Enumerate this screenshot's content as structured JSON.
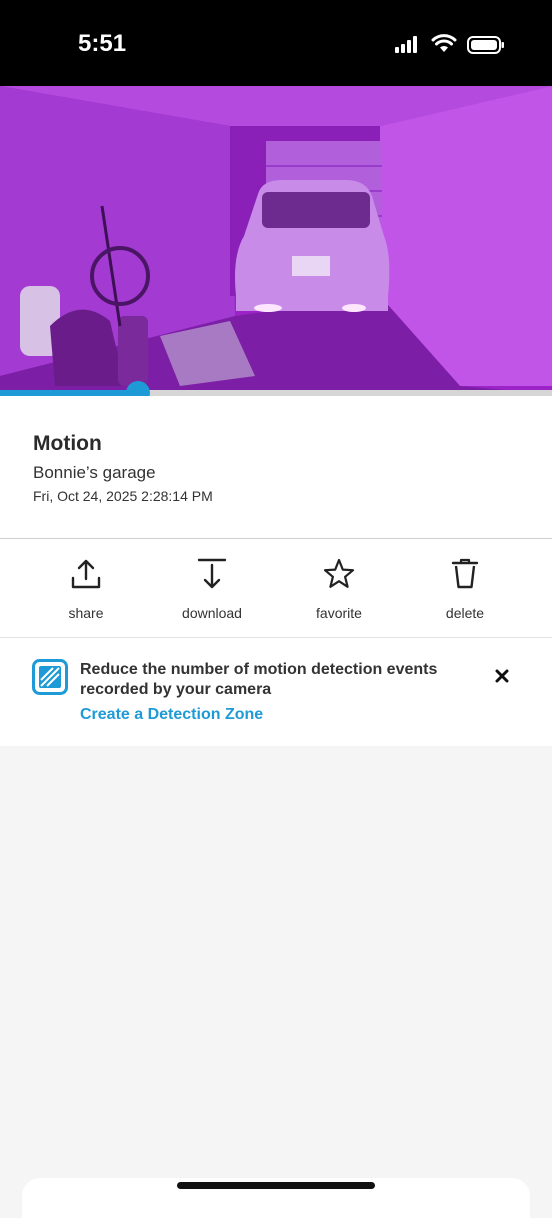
{
  "status_bar": {
    "time": "5:51"
  },
  "event": {
    "title": "Motion",
    "device": "Bonnie’s garage",
    "timestamp": "Fri, Oct 24, 2025 2:28:14 PM"
  },
  "playback": {
    "progress": 0.25
  },
  "actions": [
    {
      "label": "share",
      "icon": "share-icon"
    },
    {
      "label": "download",
      "icon": "download-icon"
    },
    {
      "label": "favorite",
      "icon": "star-icon"
    },
    {
      "label": "delete",
      "icon": "trash-icon"
    }
  ],
  "tip": {
    "message": "Reduce the number of motion detection events recorded by your camera",
    "link": "Create a Detection Zone",
    "icon": "detection-zone-icon"
  },
  "colors": {
    "accent": "#1e9bd7",
    "video_tint": "#9b23c7"
  }
}
